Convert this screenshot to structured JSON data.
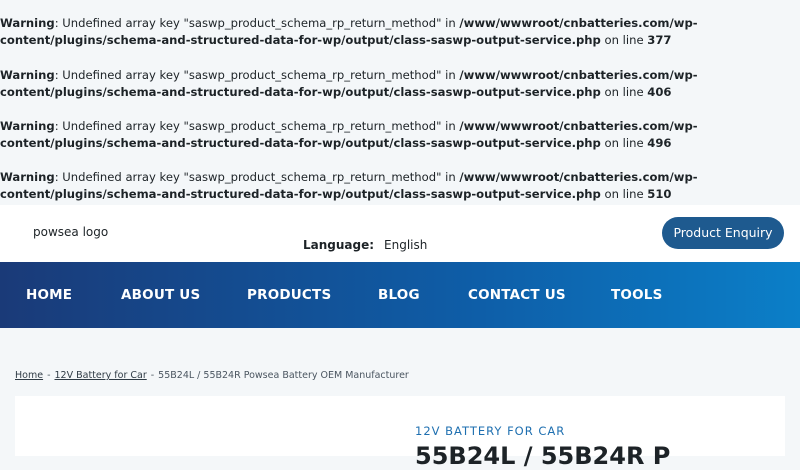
{
  "warnings": [
    {
      "label": "Warning",
      "message": ": Undefined array key \"saswp_product_schema_rp_return_method\" in ",
      "path": "/www/wwwroot/cnbatteries.com/wp-content/plugins/schema-and-structured-data-for-wp/output/class-saswp-output-service.php",
      "on_line": " on line ",
      "line": "377"
    },
    {
      "label": "Warning",
      "message": ": Undefined array key \"saswp_product_schema_rp_return_method\" in ",
      "path": "/www/wwwroot/cnbatteries.com/wp-content/plugins/schema-and-structured-data-for-wp/output/class-saswp-output-service.php",
      "on_line": " on line ",
      "line": "406"
    },
    {
      "label": "Warning",
      "message": ": Undefined array key \"saswp_product_schema_rp_return_method\" in ",
      "path": "/www/wwwroot/cnbatteries.com/wp-content/plugins/schema-and-structured-data-for-wp/output/class-saswp-output-service.php",
      "on_line": " on line ",
      "line": "496"
    },
    {
      "label": "Warning",
      "message": ": Undefined array key \"saswp_product_schema_rp_return_method\" in ",
      "path": "/www/wwwroot/cnbatteries.com/wp-content/plugins/schema-and-structured-data-for-wp/output/class-saswp-output-service.php",
      "on_line": " on line ",
      "line": "510"
    }
  ],
  "header": {
    "logo_alt": "powsea logo",
    "language_label": "Language:",
    "language_value": "English",
    "enquiry_button": "Product Enquiry"
  },
  "nav": {
    "items": [
      "HOME",
      "ABOUT US",
      "PRODUCTS",
      "BLOG",
      "CONTACT US",
      "TOOLS"
    ]
  },
  "breadcrumb": {
    "home": "Home",
    "sep": "-",
    "category": "12V Battery for Car",
    "current": "55B24L / 55B24R Powsea Battery OEM Manufacturer"
  },
  "product": {
    "category": "12V BATTERY FOR CAR",
    "title": "55B24L / 55B24R P"
  },
  "colors": {
    "accent": "#1e5a8f",
    "nav_start": "#1a3a78",
    "nav_end": "#0b7fc8"
  }
}
